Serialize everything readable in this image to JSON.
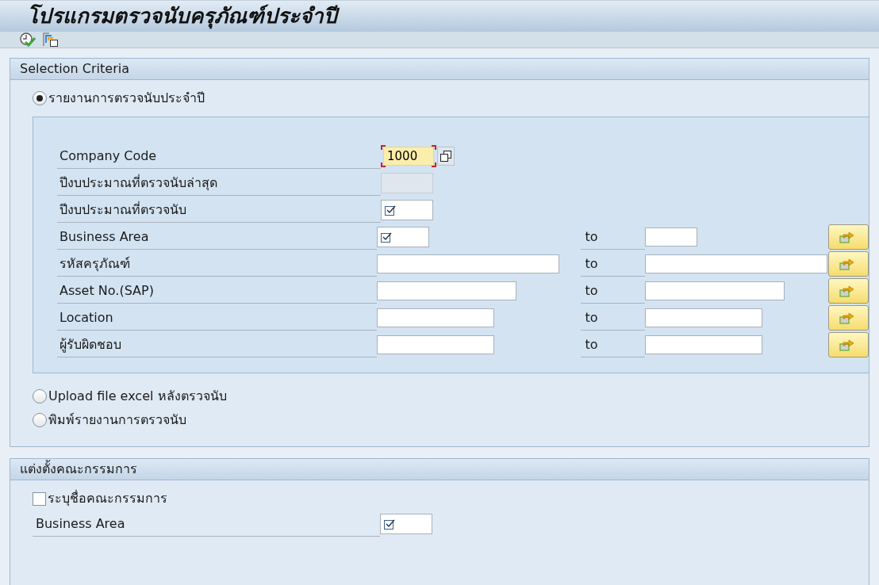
{
  "title": "โปรแกรมตรวจนับครุภัณฑ์ประจำปี",
  "toolbar": [
    {
      "kind": "execute"
    },
    {
      "kind": "variants"
    }
  ],
  "selection_criteria": {
    "title": "Selection Criteria",
    "options": [
      {
        "label": "รายงานการตรวจนับประจำปี",
        "selected": true,
        "rows": [
          {
            "label": "Company Code",
            "field": {
              "kind": "text",
              "value": "1000",
              "focused": true,
              "help": true
            }
          },
          {
            "label": "ปีงบประมาณที่ตรวจนับล่าสุด",
            "field": {
              "kind": "readonly"
            }
          },
          {
            "label": "ปีงบประมาณที่ตรวจนับ",
            "field": {
              "kind": "required"
            }
          },
          {
            "label": "Business Area",
            "field": {
              "kind": "required"
            },
            "to": {
              "label": "to",
              "field": {
                "kind": "text"
              }
            },
            "multiple": true
          },
          {
            "label": "รหัสครุภัณฑ์",
            "field": {
              "kind": "text"
            },
            "to": {
              "label": "to",
              "field": {
                "kind": "text"
              }
            },
            "multiple": true
          },
          {
            "label": "Asset No.(SAP)",
            "field": {
              "kind": "text"
            },
            "to": {
              "label": "to",
              "field": {
                "kind": "text"
              }
            },
            "multiple": true
          },
          {
            "label": "Location",
            "field": {
              "kind": "text"
            },
            "to": {
              "label": "to",
              "field": {
                "kind": "text"
              }
            },
            "multiple": true
          },
          {
            "label": "ผู้รับผิดชอบ",
            "field": {
              "kind": "text"
            },
            "to": {
              "label": "to",
              "field": {
                "kind": "text"
              }
            },
            "multiple": true
          }
        ]
      },
      {
        "label": "Upload file excel หลังตรวจนับ",
        "selected": false
      },
      {
        "label": "พิมพ์รายงานการตรวจนับ",
        "selected": false
      }
    ]
  },
  "committee": {
    "title": "แต่งตั้งคณะกรรมการ",
    "checkbox": {
      "label": "ระบุชื่อคณะกรรมการ",
      "checked": false
    },
    "rows": [
      {
        "label": "Business Area",
        "field": {
          "kind": "required"
        }
      }
    ]
  }
}
